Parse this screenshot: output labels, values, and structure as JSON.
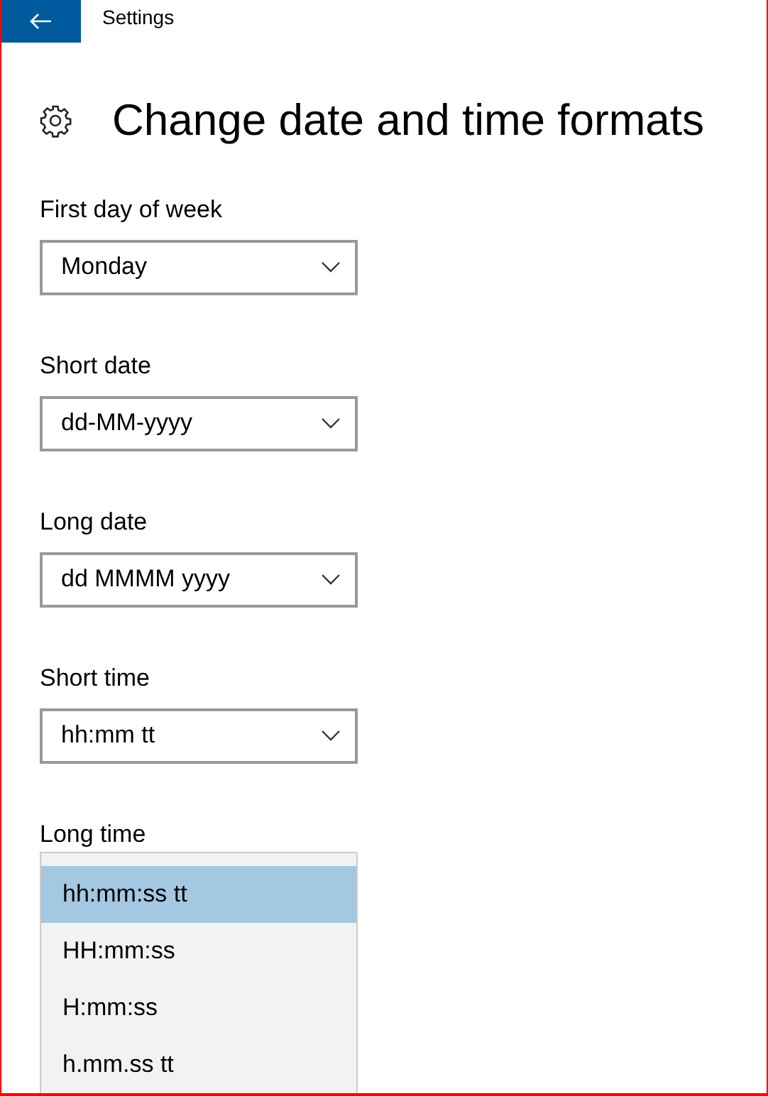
{
  "window": {
    "title": "Settings"
  },
  "page_title": "Change date and time formats",
  "fields": [
    {
      "kind": "dropdown",
      "label": "First day of week",
      "value": "Monday"
    },
    {
      "kind": "dropdown",
      "label": "Short date",
      "value": "dd-MM-yyyy"
    },
    {
      "kind": "dropdown",
      "label": "Long date",
      "value": "dd MMMM yyyy"
    },
    {
      "kind": "dropdown",
      "label": "Short time",
      "value": "hh:mm tt"
    },
    {
      "kind": "open_list",
      "label": "Long time",
      "options": [
        {
          "label": "hh:mm:ss tt",
          "selected": true
        },
        {
          "label": "HH:mm:ss",
          "selected": false
        },
        {
          "label": "H:mm:ss",
          "selected": false
        },
        {
          "label": "h.mm.ss tt",
          "selected": false
        }
      ]
    }
  ]
}
